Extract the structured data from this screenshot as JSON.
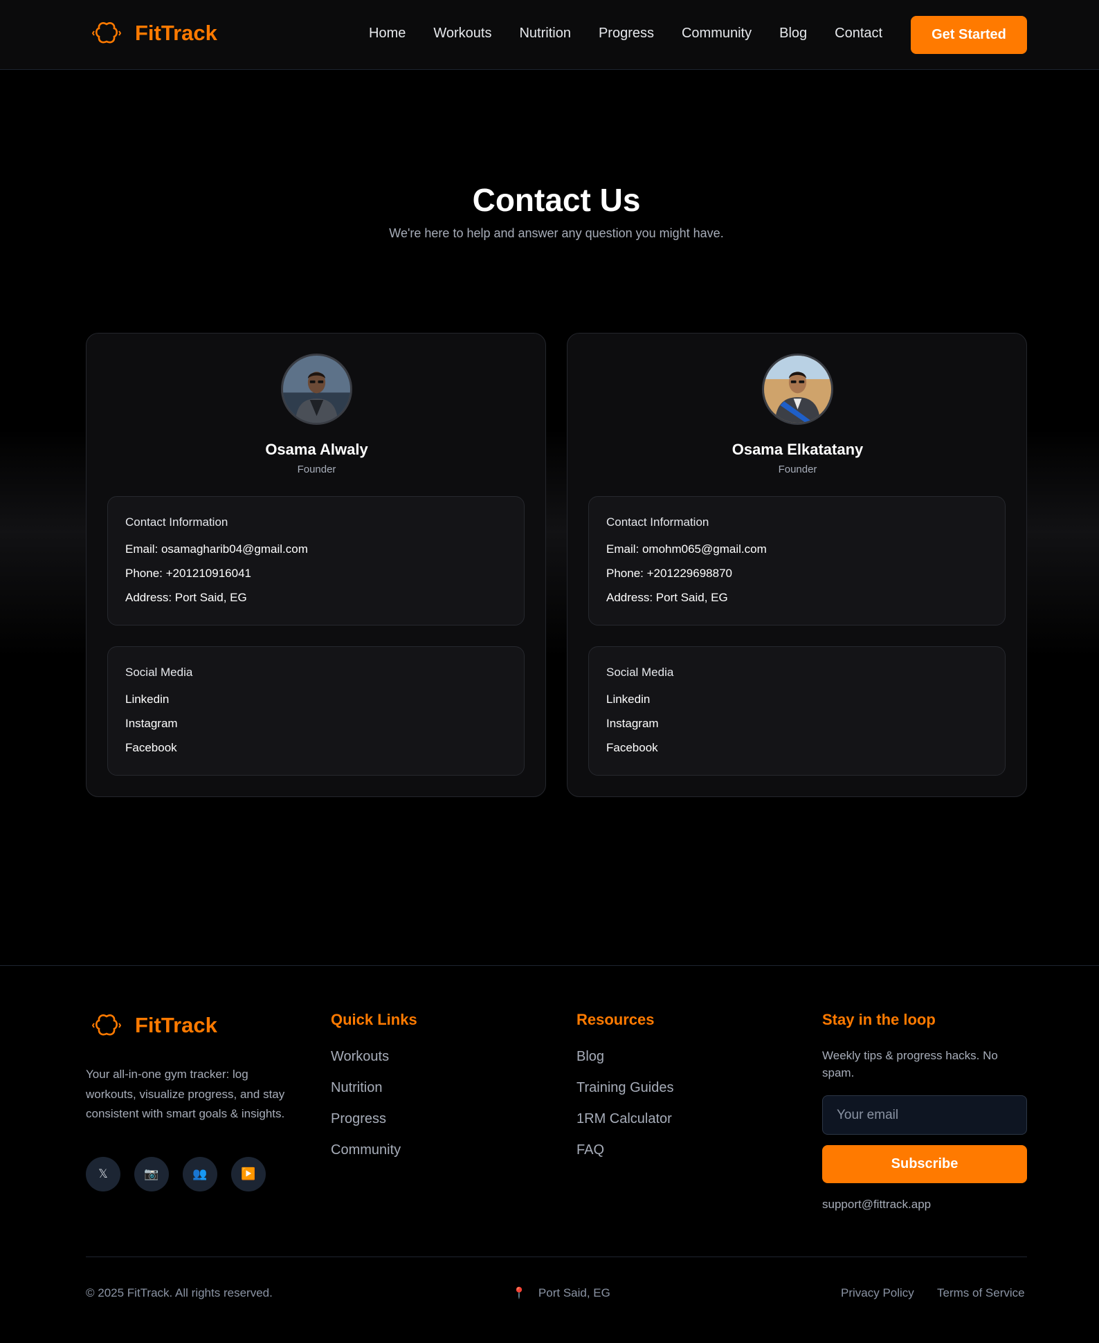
{
  "header": {
    "brand": "FitTrack",
    "nav": [
      "Home",
      "Workouts",
      "Nutrition",
      "Progress",
      "Community",
      "Blog",
      "Contact"
    ],
    "cta": "Get Started"
  },
  "hero": {
    "title": "Contact Us",
    "subtitle": "We're here to help and answer any question you might have."
  },
  "contacts": [
    {
      "name": "Osama Alwaly",
      "role": "Founder",
      "info_title": "Contact Information",
      "email": "Email: osamagharib04@gmail.com",
      "phone": "Phone: +201210916041",
      "address": "Address: Port Said, EG",
      "social_title": "Social Media",
      "social": [
        "Linkedin",
        "Instagram",
        "Facebook"
      ]
    },
    {
      "name": "Osama Elkatatany",
      "role": "Founder",
      "info_title": "Contact Information",
      "email": "Email: omohm065@gmail.com",
      "phone": "Phone: +201229698870",
      "address": "Address: Port Said, EG",
      "social_title": "Social Media",
      "social": [
        "Linkedin",
        "Instagram",
        "Facebook"
      ]
    }
  ],
  "footer": {
    "brand": "FitTrack",
    "description": "Your all-in-one gym tracker: log workouts, visualize progress, and stay consistent with smart goals & insights.",
    "social_icons": [
      "𝕏",
      "📷",
      "👥",
      "▶️"
    ],
    "quick_links": {
      "title": "Quick Links",
      "items": [
        "Workouts",
        "Nutrition",
        "Progress",
        "Community"
      ]
    },
    "resources": {
      "title": "Resources",
      "items": [
        "Blog",
        "Training Guides",
        "1RM Calculator",
        "FAQ"
      ]
    },
    "newsletter": {
      "title": "Stay in the loop",
      "description": "Weekly tips & progress hacks. No spam.",
      "placeholder": "Your email",
      "button": "Subscribe",
      "support_email": "support@fittrack.app"
    },
    "copyright": "© 2025 FitTrack. All rights reserved.",
    "location_icon": "📍",
    "location": "Port Said, EG",
    "privacy": "Privacy Policy",
    "terms": "Terms of Service"
  },
  "colors": {
    "accent": "#ff7a00",
    "background": "#000000",
    "card": "#0d0d0f",
    "muted_text": "#a7adb9"
  }
}
